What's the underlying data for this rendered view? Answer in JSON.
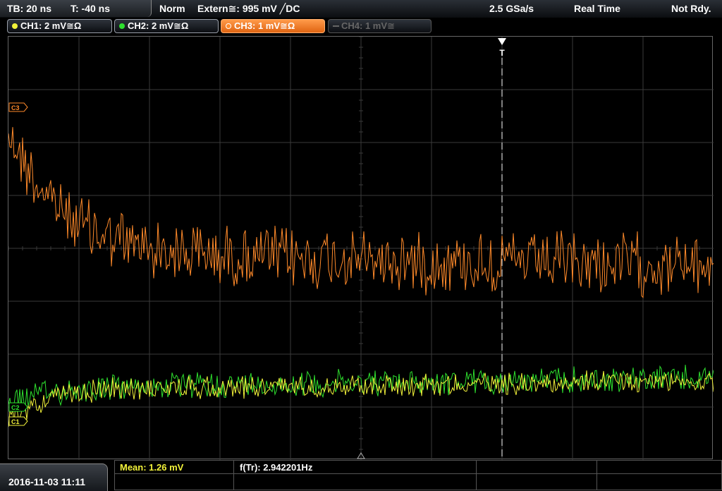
{
  "topbar": {
    "timebase": "TB: 20 ns",
    "trigger_time": "T: -40 ns",
    "mode": "Norm",
    "trigger_source": "Extern≅: 995 mV ╱DC",
    "sample_rate": "2.5 GSa/s",
    "acq_mode": "Real Time",
    "status": "Not Rdy."
  },
  "channels": [
    {
      "label": "CH1: 2 mV≅Ω",
      "color": "#f2f23a",
      "state": "on"
    },
    {
      "label": "CH2: 2 mV≅Ω",
      "color": "#2ee02e",
      "state": "on"
    },
    {
      "label": "CH3: 1 mV≅Ω",
      "color": "#ff8a2a",
      "state": "active"
    },
    {
      "label": "CH4: 1 mV≅",
      "color": "#666666",
      "state": "off"
    }
  ],
  "markers": {
    "trigger_label": "T",
    "ch3_marker": "C3",
    "ch2_marker": "C2",
    "ch1_marker": "C1"
  },
  "bottombar": {
    "datetime": "2016-11-03 11:11",
    "mean": "Mean: 1.26 mV",
    "freq": "f(Tr): 2.942201Hz"
  },
  "colors": {
    "ch1": "#f2f23a",
    "ch2": "#2ee02e",
    "ch3": "#ff8a2a",
    "grid": "#3a3a3a",
    "mean_text": "#f2f23a"
  }
}
